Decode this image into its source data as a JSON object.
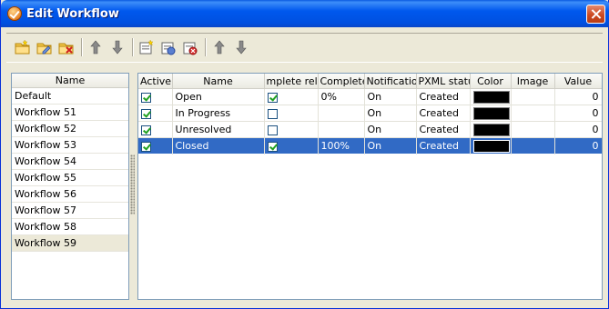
{
  "window": {
    "title": "Edit Workflow"
  },
  "toolbar": {
    "icons": [
      "new-workflow-icon",
      "edit-workflow-icon",
      "delete-workflow-icon",
      "move-up-icon",
      "move-down-icon",
      "new-status-icon",
      "edit-status-icon",
      "delete-status-icon",
      "status-move-up-icon",
      "status-move-down-icon"
    ]
  },
  "workflows": {
    "header": "Name",
    "items": [
      "Default",
      "Workflow 51",
      "Workflow 52",
      "Workflow 53",
      "Workflow 54",
      "Workflow 55",
      "Workflow 56",
      "Workflow 57",
      "Workflow 58",
      "Workflow 59"
    ],
    "selected": "Workflow 59"
  },
  "statuses": {
    "columns": [
      "Active",
      "Name",
      "mplete relat",
      "Complete",
      "Notification",
      "PXML statu",
      "Color",
      "Image",
      "Value"
    ],
    "rows": [
      {
        "active": true,
        "name": "Open",
        "complete_related": true,
        "complete": "0%",
        "notification": "On",
        "pxml_status": "Created",
        "color": "#000000",
        "image": "",
        "value": "0"
      },
      {
        "active": true,
        "name": "In Progress",
        "complete_related": false,
        "complete": "",
        "notification": "On",
        "pxml_status": "Created",
        "color": "#000000",
        "image": "",
        "value": "0"
      },
      {
        "active": true,
        "name": "Unresolved",
        "complete_related": false,
        "complete": "",
        "notification": "On",
        "pxml_status": "Created",
        "color": "#000000",
        "image": "",
        "value": "0"
      },
      {
        "active": true,
        "name": "Closed",
        "complete_related": true,
        "complete": "100%",
        "notification": "On",
        "pxml_status": "Created",
        "color": "#000000",
        "image": "",
        "value": "0"
      }
    ],
    "selected_row": 3
  }
}
